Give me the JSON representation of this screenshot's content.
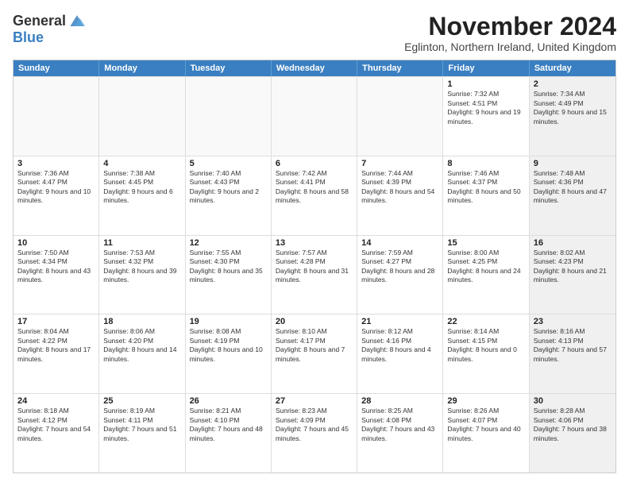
{
  "logo": {
    "general": "General",
    "blue": "Blue"
  },
  "title": "November 2024",
  "subtitle": "Eglinton, Northern Ireland, United Kingdom",
  "headers": [
    "Sunday",
    "Monday",
    "Tuesday",
    "Wednesday",
    "Thursday",
    "Friday",
    "Saturday"
  ],
  "rows": [
    [
      {
        "day": "",
        "info": "",
        "empty": true
      },
      {
        "day": "",
        "info": "",
        "empty": true
      },
      {
        "day": "",
        "info": "",
        "empty": true
      },
      {
        "day": "",
        "info": "",
        "empty": true
      },
      {
        "day": "",
        "info": "",
        "empty": true
      },
      {
        "day": "1",
        "info": "Sunrise: 7:32 AM\nSunset: 4:51 PM\nDaylight: 9 hours and 19 minutes.",
        "empty": false,
        "shaded": false
      },
      {
        "day": "2",
        "info": "Sunrise: 7:34 AM\nSunset: 4:49 PM\nDaylight: 9 hours and 15 minutes.",
        "empty": false,
        "shaded": true
      }
    ],
    [
      {
        "day": "3",
        "info": "Sunrise: 7:36 AM\nSunset: 4:47 PM\nDaylight: 9 hours and 10 minutes.",
        "empty": false,
        "shaded": false
      },
      {
        "day": "4",
        "info": "Sunrise: 7:38 AM\nSunset: 4:45 PM\nDaylight: 9 hours and 6 minutes.",
        "empty": false,
        "shaded": false
      },
      {
        "day": "5",
        "info": "Sunrise: 7:40 AM\nSunset: 4:43 PM\nDaylight: 9 hours and 2 minutes.",
        "empty": false,
        "shaded": false
      },
      {
        "day": "6",
        "info": "Sunrise: 7:42 AM\nSunset: 4:41 PM\nDaylight: 8 hours and 58 minutes.",
        "empty": false,
        "shaded": false
      },
      {
        "day": "7",
        "info": "Sunrise: 7:44 AM\nSunset: 4:39 PM\nDaylight: 8 hours and 54 minutes.",
        "empty": false,
        "shaded": false
      },
      {
        "day": "8",
        "info": "Sunrise: 7:46 AM\nSunset: 4:37 PM\nDaylight: 8 hours and 50 minutes.",
        "empty": false,
        "shaded": false
      },
      {
        "day": "9",
        "info": "Sunrise: 7:48 AM\nSunset: 4:36 PM\nDaylight: 8 hours and 47 minutes.",
        "empty": false,
        "shaded": true
      }
    ],
    [
      {
        "day": "10",
        "info": "Sunrise: 7:50 AM\nSunset: 4:34 PM\nDaylight: 8 hours and 43 minutes.",
        "empty": false,
        "shaded": false
      },
      {
        "day": "11",
        "info": "Sunrise: 7:53 AM\nSunset: 4:32 PM\nDaylight: 8 hours and 39 minutes.",
        "empty": false,
        "shaded": false
      },
      {
        "day": "12",
        "info": "Sunrise: 7:55 AM\nSunset: 4:30 PM\nDaylight: 8 hours and 35 minutes.",
        "empty": false,
        "shaded": false
      },
      {
        "day": "13",
        "info": "Sunrise: 7:57 AM\nSunset: 4:28 PM\nDaylight: 8 hours and 31 minutes.",
        "empty": false,
        "shaded": false
      },
      {
        "day": "14",
        "info": "Sunrise: 7:59 AM\nSunset: 4:27 PM\nDaylight: 8 hours and 28 minutes.",
        "empty": false,
        "shaded": false
      },
      {
        "day": "15",
        "info": "Sunrise: 8:00 AM\nSunset: 4:25 PM\nDaylight: 8 hours and 24 minutes.",
        "empty": false,
        "shaded": false
      },
      {
        "day": "16",
        "info": "Sunrise: 8:02 AM\nSunset: 4:23 PM\nDaylight: 8 hours and 21 minutes.",
        "empty": false,
        "shaded": true
      }
    ],
    [
      {
        "day": "17",
        "info": "Sunrise: 8:04 AM\nSunset: 4:22 PM\nDaylight: 8 hours and 17 minutes.",
        "empty": false,
        "shaded": false
      },
      {
        "day": "18",
        "info": "Sunrise: 8:06 AM\nSunset: 4:20 PM\nDaylight: 8 hours and 14 minutes.",
        "empty": false,
        "shaded": false
      },
      {
        "day": "19",
        "info": "Sunrise: 8:08 AM\nSunset: 4:19 PM\nDaylight: 8 hours and 10 minutes.",
        "empty": false,
        "shaded": false
      },
      {
        "day": "20",
        "info": "Sunrise: 8:10 AM\nSunset: 4:17 PM\nDaylight: 8 hours and 7 minutes.",
        "empty": false,
        "shaded": false
      },
      {
        "day": "21",
        "info": "Sunrise: 8:12 AM\nSunset: 4:16 PM\nDaylight: 8 hours and 4 minutes.",
        "empty": false,
        "shaded": false
      },
      {
        "day": "22",
        "info": "Sunrise: 8:14 AM\nSunset: 4:15 PM\nDaylight: 8 hours and 0 minutes.",
        "empty": false,
        "shaded": false
      },
      {
        "day": "23",
        "info": "Sunrise: 8:16 AM\nSunset: 4:13 PM\nDaylight: 7 hours and 57 minutes.",
        "empty": false,
        "shaded": true
      }
    ],
    [
      {
        "day": "24",
        "info": "Sunrise: 8:18 AM\nSunset: 4:12 PM\nDaylight: 7 hours and 54 minutes.",
        "empty": false,
        "shaded": false
      },
      {
        "day": "25",
        "info": "Sunrise: 8:19 AM\nSunset: 4:11 PM\nDaylight: 7 hours and 51 minutes.",
        "empty": false,
        "shaded": false
      },
      {
        "day": "26",
        "info": "Sunrise: 8:21 AM\nSunset: 4:10 PM\nDaylight: 7 hours and 48 minutes.",
        "empty": false,
        "shaded": false
      },
      {
        "day": "27",
        "info": "Sunrise: 8:23 AM\nSunset: 4:09 PM\nDaylight: 7 hours and 45 minutes.",
        "empty": false,
        "shaded": false
      },
      {
        "day": "28",
        "info": "Sunrise: 8:25 AM\nSunset: 4:08 PM\nDaylight: 7 hours and 43 minutes.",
        "empty": false,
        "shaded": false
      },
      {
        "day": "29",
        "info": "Sunrise: 8:26 AM\nSunset: 4:07 PM\nDaylight: 7 hours and 40 minutes.",
        "empty": false,
        "shaded": false
      },
      {
        "day": "30",
        "info": "Sunrise: 8:28 AM\nSunset: 4:06 PM\nDaylight: 7 hours and 38 minutes.",
        "empty": false,
        "shaded": true
      }
    ]
  ]
}
